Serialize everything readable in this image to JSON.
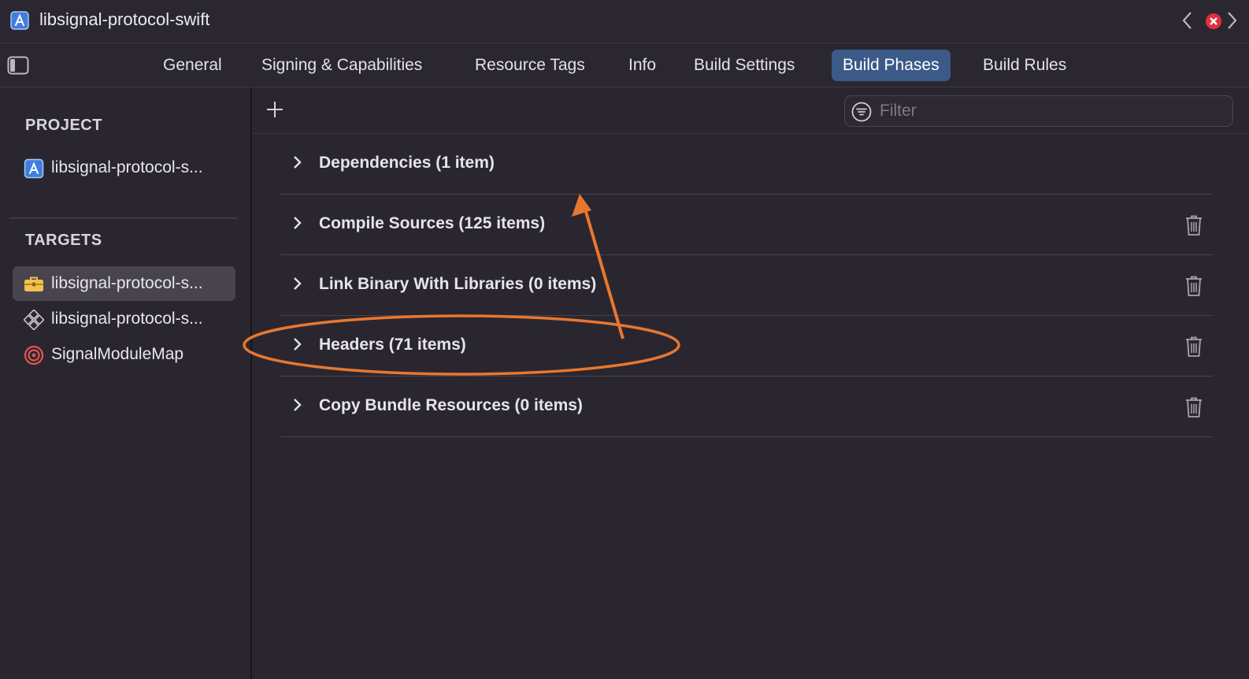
{
  "window": {
    "title": "libsignal-protocol-swift",
    "icons": [
      "xcode-project-icon",
      "chevron-left-icon",
      "close-error-icon",
      "chevron-right-icon"
    ]
  },
  "tabs": [
    {
      "label": "General",
      "active": false
    },
    {
      "label": "Signing & Capabilities",
      "active": false
    },
    {
      "label": "Resource Tags",
      "active": false
    },
    {
      "label": "Info",
      "active": false
    },
    {
      "label": "Build Settings",
      "active": false
    },
    {
      "label": "Build Phases",
      "active": true
    },
    {
      "label": "Build Rules",
      "active": false
    }
  ],
  "sidebar": {
    "project_header": "PROJECT",
    "project_item": {
      "label": "libsignal-protocol-s...",
      "icon": "xcode-project-icon"
    },
    "targets_header": "TARGETS",
    "targets": [
      {
        "label": "libsignal-protocol-s...",
        "icon": "toolbox-icon",
        "selected": true
      },
      {
        "label": "libsignal-protocol-s...",
        "icon": "framework-diamond-icon",
        "selected": false
      },
      {
        "label": "SignalModuleMap",
        "icon": "target-icon",
        "selected": false
      }
    ]
  },
  "toolbar": {
    "filter_placeholder": "Filter"
  },
  "phases": [
    {
      "label": "Dependencies (1 item)",
      "deletable": false
    },
    {
      "label": "Compile Sources (125 items)",
      "deletable": true
    },
    {
      "label": "Link Binary With Libraries (0 items)",
      "deletable": true
    },
    {
      "label": "Headers (71 items)",
      "deletable": true
    },
    {
      "label": "Copy Bundle Resources (0 items)",
      "deletable": true
    }
  ],
  "annotation": {
    "color": "#e8772e"
  }
}
